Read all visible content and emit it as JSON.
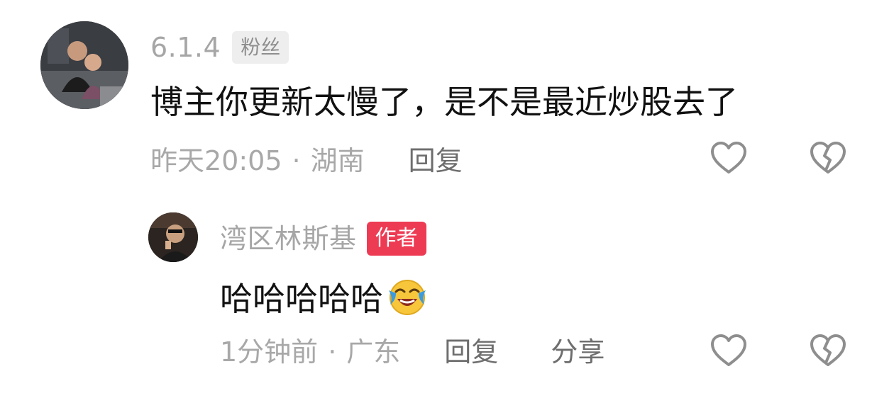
{
  "comments": [
    {
      "username": "6.1.4",
      "badge": "粉丝",
      "text": "博主你更新太慢了，是不是最近炒股去了",
      "time": "昨天20:05",
      "separator": "·",
      "location": "湖南",
      "reply_label": "回复",
      "like_icon": "heart-icon",
      "dislike_icon": "broken-heart-icon"
    },
    {
      "username": "湾区林斯基",
      "badge": "作者",
      "text": "哈哈哈哈哈",
      "emoji": "laughing-crying-emoji",
      "time": "1分钟前",
      "separator": "·",
      "location": "广东",
      "reply_label": "回复",
      "share_label": "分享",
      "like_icon": "heart-icon",
      "dislike_icon": "broken-heart-icon"
    }
  ],
  "colors": {
    "author_badge": "#ee3b54",
    "fan_badge_bg": "#eeeeee",
    "muted_text": "#a8a8a8",
    "action_text": "#6e6e6e"
  }
}
